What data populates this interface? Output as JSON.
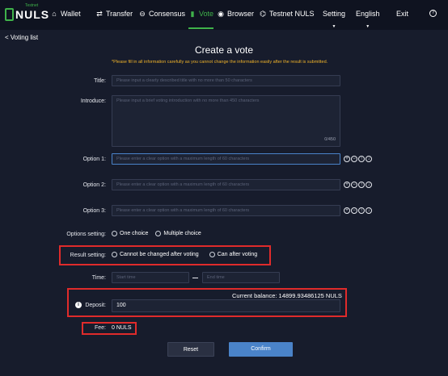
{
  "header": {
    "logo_subtitle": "Testnet",
    "logo_name": "NULS",
    "nav": [
      {
        "label": "Wallet",
        "icon": "home-icon"
      },
      {
        "label": "Transfer",
        "icon": "transfer-icon"
      },
      {
        "label": "Consensus",
        "icon": "consensus-icon"
      },
      {
        "label": "Vote",
        "icon": "vote-icon"
      },
      {
        "label": "Browser",
        "icon": "browser-icon"
      },
      {
        "label": "Testnet NULS",
        "icon": "testnet-icon"
      }
    ],
    "setting": "Setting",
    "language": "English",
    "exit": "Exit",
    "help_icon": "help-icon"
  },
  "back_link": "< Voting list",
  "page_title": "Create a vote",
  "warning": "*Please fill in all information carefully as you cannot change the information easily after the result is submitted.",
  "form": {
    "title_label": "Title:",
    "title_placeholder": "Please input a clearly described title with no more than 50 characters",
    "intro_label": "Introduce:",
    "intro_placeholder": "Please input a brief voting introduction with no more than 450 characters",
    "intro_counter": "0/450",
    "options": [
      {
        "label": "Option 1:",
        "placeholder": "Please enter a clear option with a maximum length of 60 characters"
      },
      {
        "label": "Option 2:",
        "placeholder": "Please enter a clear option with a maximum length of 60 characters"
      },
      {
        "label": "Option 3:",
        "placeholder": "Please enter a clear option with a maximum length of 60 characters"
      }
    ],
    "options_setting_label": "Options setting:",
    "one_choice": "One choice",
    "multiple_choice": "Multiple choice",
    "result_setting_label": "Result setting:",
    "cannot_change": "Cannot be changed after voting",
    "can_after": "Can after voting",
    "time_label": "Time:",
    "start_time": "Start time",
    "end_time": "End time",
    "balance": "Current balance: 14899.93486125 NULS",
    "deposit_label": "Deposit:",
    "deposit_value": "100",
    "fee_label": "Fee:",
    "fee_value": "0 NULS",
    "reset": "Reset",
    "confirm": "Confirm"
  },
  "colors": {
    "accent": "#3fb24a",
    "highlight": "#e02b2b",
    "confirm": "#4a83c9",
    "warning": "#f0b32a"
  }
}
